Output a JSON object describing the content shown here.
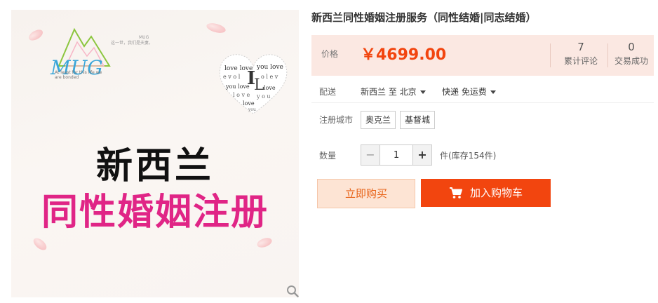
{
  "image": {
    "logo_text": "MUG",
    "logo_tagline": "At least for this life we are bonded",
    "logo_slogan": "这一世，我们是夫妻。",
    "logo_brand": "MUG",
    "heart_word": "I love you",
    "title_line1": "新西兰",
    "title_line2": "同性婚姻注册"
  },
  "product": {
    "title": "新西兰同性婚姻注册服务（同性结婚|同志结婚）"
  },
  "price": {
    "label": "价格",
    "value": "￥4699.00",
    "reviews_count": "7",
    "reviews_label": "累计评论",
    "sales_count": "0",
    "sales_label": "交易成功"
  },
  "shipping": {
    "label": "配送",
    "route": "新西兰 至  北京",
    "method": "快递 免运费"
  },
  "city": {
    "label": "注册城市",
    "options": [
      "奥克兰",
      "基督城"
    ]
  },
  "quantity": {
    "label": "数量",
    "minus": "−",
    "plus": "+",
    "value": "1",
    "stock": "件(库存154件)"
  },
  "actions": {
    "buy_now": "立即购买",
    "add_cart": "加入购物车"
  },
  "colors": {
    "accent": "#f2450f",
    "pink": "#e02586",
    "price_bg": "#fbe8e2"
  }
}
